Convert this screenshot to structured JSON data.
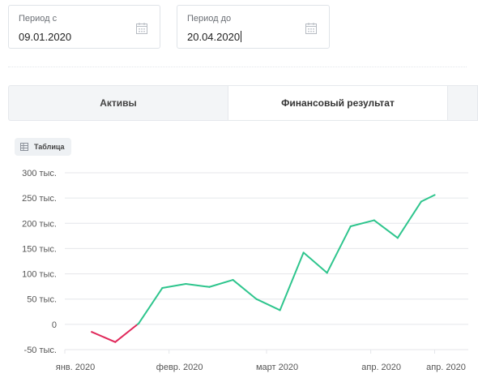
{
  "filters": {
    "from": {
      "label": "Период с",
      "value": "09.01.2020"
    },
    "to": {
      "label": "Период до",
      "value": "20.04.2020"
    }
  },
  "tabs": [
    {
      "label": "Активы",
      "active": false
    },
    {
      "label": "Финансовый результат",
      "active": true
    }
  ],
  "table_button": {
    "label": "Таблица",
    "icon": "table-icon"
  },
  "colors": {
    "positive": "#2ec58d",
    "negative": "#e0285a",
    "grid": "#e4e6ea"
  },
  "chart_data": {
    "type": "line",
    "x_tick_labels": [
      "янв. 2020",
      "февр. 2020",
      "март 2020",
      "апр. 2020",
      "апр. 2020"
    ],
    "y_tick_labels": [
      "300 тыс.",
      "250 тыс.",
      "200 тыс.",
      "150 тыс.",
      "100 тыс.",
      "50 тыс.",
      "0",
      "-50 тыс."
    ],
    "ylim": [
      -50000,
      300000
    ],
    "x": [
      "09.01.2020",
      "16.01.2020",
      "23.01.2020",
      "30.01.2020",
      "06.02.2020",
      "13.02.2020",
      "20.02.2020",
      "27.02.2020",
      "05.03.2020",
      "12.03.2020",
      "19.03.2020",
      "26.03.2020",
      "02.04.2020",
      "09.04.2020",
      "16.04.2020",
      "20.04.2020"
    ],
    "series": [
      {
        "values": [
          -15000,
          -35000,
          2000,
          72000,
          80000,
          74000,
          88000,
          50000,
          28000,
          142000,
          102000,
          194000,
          206000,
          171000,
          243000,
          256000
        ]
      }
    ],
    "grid": true
  }
}
